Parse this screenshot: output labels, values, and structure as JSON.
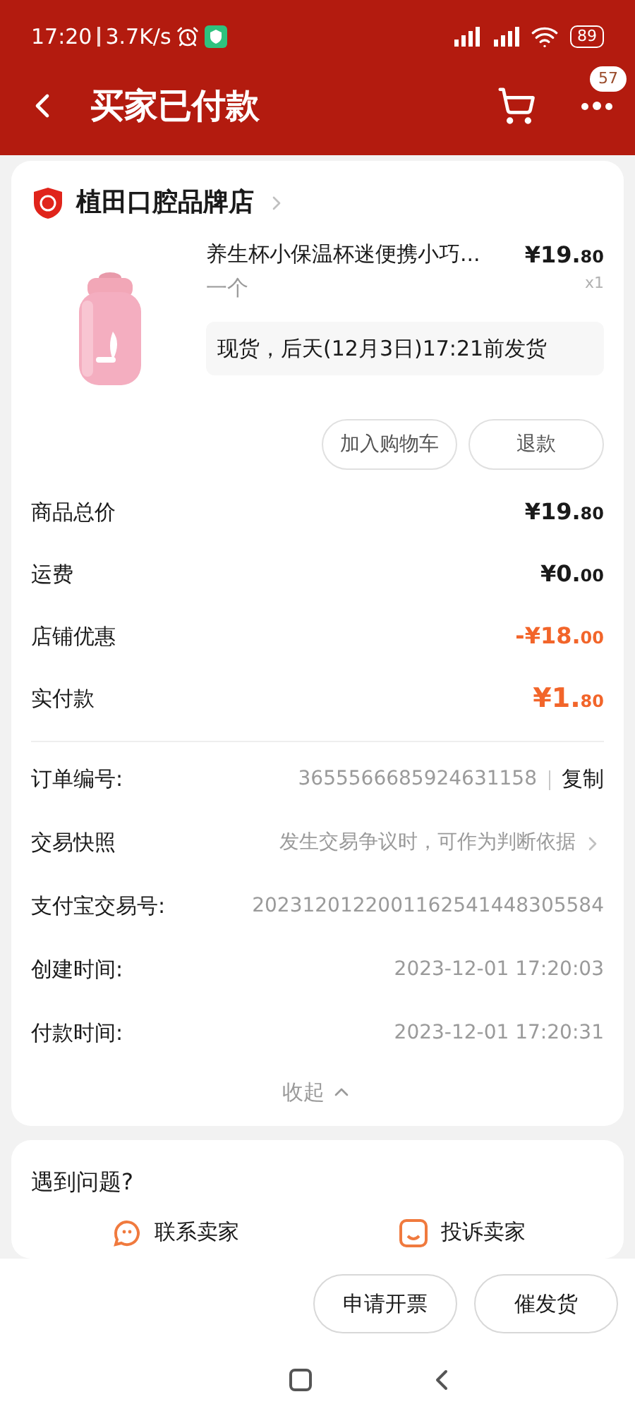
{
  "status_bar": {
    "time": "17:20",
    "speed": "3.7K/s",
    "battery": "89"
  },
  "header": {
    "title": "买家已付款",
    "badge": "57"
  },
  "store": {
    "name": "植田口腔品牌店"
  },
  "product": {
    "title": "养生杯小保温杯迷便携小巧...",
    "spec": "一个",
    "price_main": "¥19.",
    "price_decimal": "80",
    "quantity": "x1",
    "shipping": "现货，后天(12月3日)17:21前发货",
    "buttons": [
      "加入购物车",
      "退款"
    ]
  },
  "price_rows": [
    {
      "label": "商品总价",
      "main": "¥19.",
      "decimal": "80",
      "kind": "normal"
    },
    {
      "label": "运费",
      "main": "¥0.",
      "decimal": "00",
      "kind": "normal"
    },
    {
      "label": "店铺优惠",
      "main": "-¥18.",
      "decimal": "00",
      "kind": "discount"
    },
    {
      "label": "实付款",
      "main": "¥1.",
      "decimal": "80",
      "kind": "total"
    }
  ],
  "info_rows": [
    {
      "label": "订单编号:",
      "value": "3655566685924631158",
      "action": "复制",
      "kind": "copy"
    },
    {
      "label": "交易快照",
      "value": "发生交易争议时，可作为判断依据",
      "kind": "link"
    },
    {
      "label": "支付宝交易号:",
      "value": "2023120122001162541448305584",
      "kind": "plain"
    },
    {
      "label": "创建时间:",
      "value": "2023-12-01 17:20:03",
      "kind": "plain"
    },
    {
      "label": "付款时间:",
      "value": "2023-12-01 17:20:31",
      "kind": "plain"
    }
  ],
  "collapse": "收起",
  "help": {
    "title": "遇到问题?",
    "items": [
      {
        "label": "联系卖家",
        "kind": "chat"
      },
      {
        "label": "投诉卖家",
        "kind": "complaint"
      }
    ]
  },
  "bottom_buttons": [
    "申请开票",
    "催发货"
  ]
}
